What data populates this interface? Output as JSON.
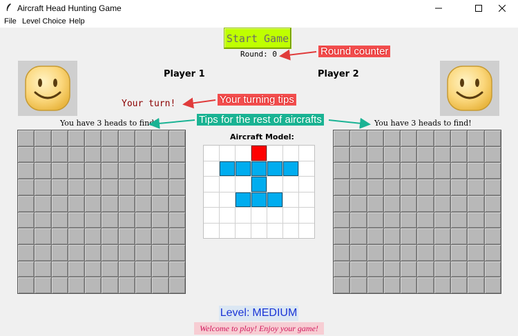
{
  "window": {
    "title": "Aircraft Head Hunting Game",
    "icons": [
      "feather-icon",
      "minimize-icon",
      "maximize-icon",
      "close-icon"
    ]
  },
  "menu": [
    "File",
    "Level Choice",
    "Help"
  ],
  "start_button": "Start Game",
  "round": "Round: 0",
  "players": {
    "p1": "Player 1",
    "p2": "Player 2"
  },
  "turn": "Your turn!",
  "heads_left": "You have 3 heads to find!",
  "heads_right": "You have 3 heads to find!",
  "model_label": "Aircraft Model:",
  "level": {
    "label": "Level:",
    "value": "MEDIUM"
  },
  "welcome": "Welcome to play! Enjoy your game!",
  "annotations": {
    "round": "Round counter",
    "turn": "Your turning tips",
    "rest": "Tips for the rest of aircrafts"
  },
  "colors": {
    "start_button": "#bfff00",
    "aircraft_head": "#ff0000",
    "aircraft_body": "#00adef",
    "turn_text": "#8b0000",
    "level_text": "#1a35d6",
    "welcome_text": "#d0165b",
    "annotation_red": "#f24e4e",
    "annotation_green": "#1ab394"
  },
  "aircraft_model": [
    [
      "e",
      "e",
      "e",
      "h",
      "e",
      "e",
      "e"
    ],
    [
      "e",
      "b",
      "b",
      "b",
      "b",
      "b",
      "e"
    ],
    [
      "e",
      "e",
      "e",
      "b",
      "e",
      "e",
      "e"
    ],
    [
      "e",
      "e",
      "b",
      "b",
      "b",
      "e",
      "e"
    ],
    [
      "e",
      "e",
      "e",
      "e",
      "e",
      "e",
      "e"
    ],
    [
      "e",
      "e",
      "e",
      "e",
      "e",
      "e",
      "e"
    ]
  ],
  "board": {
    "rows": 10,
    "cols": 10
  }
}
